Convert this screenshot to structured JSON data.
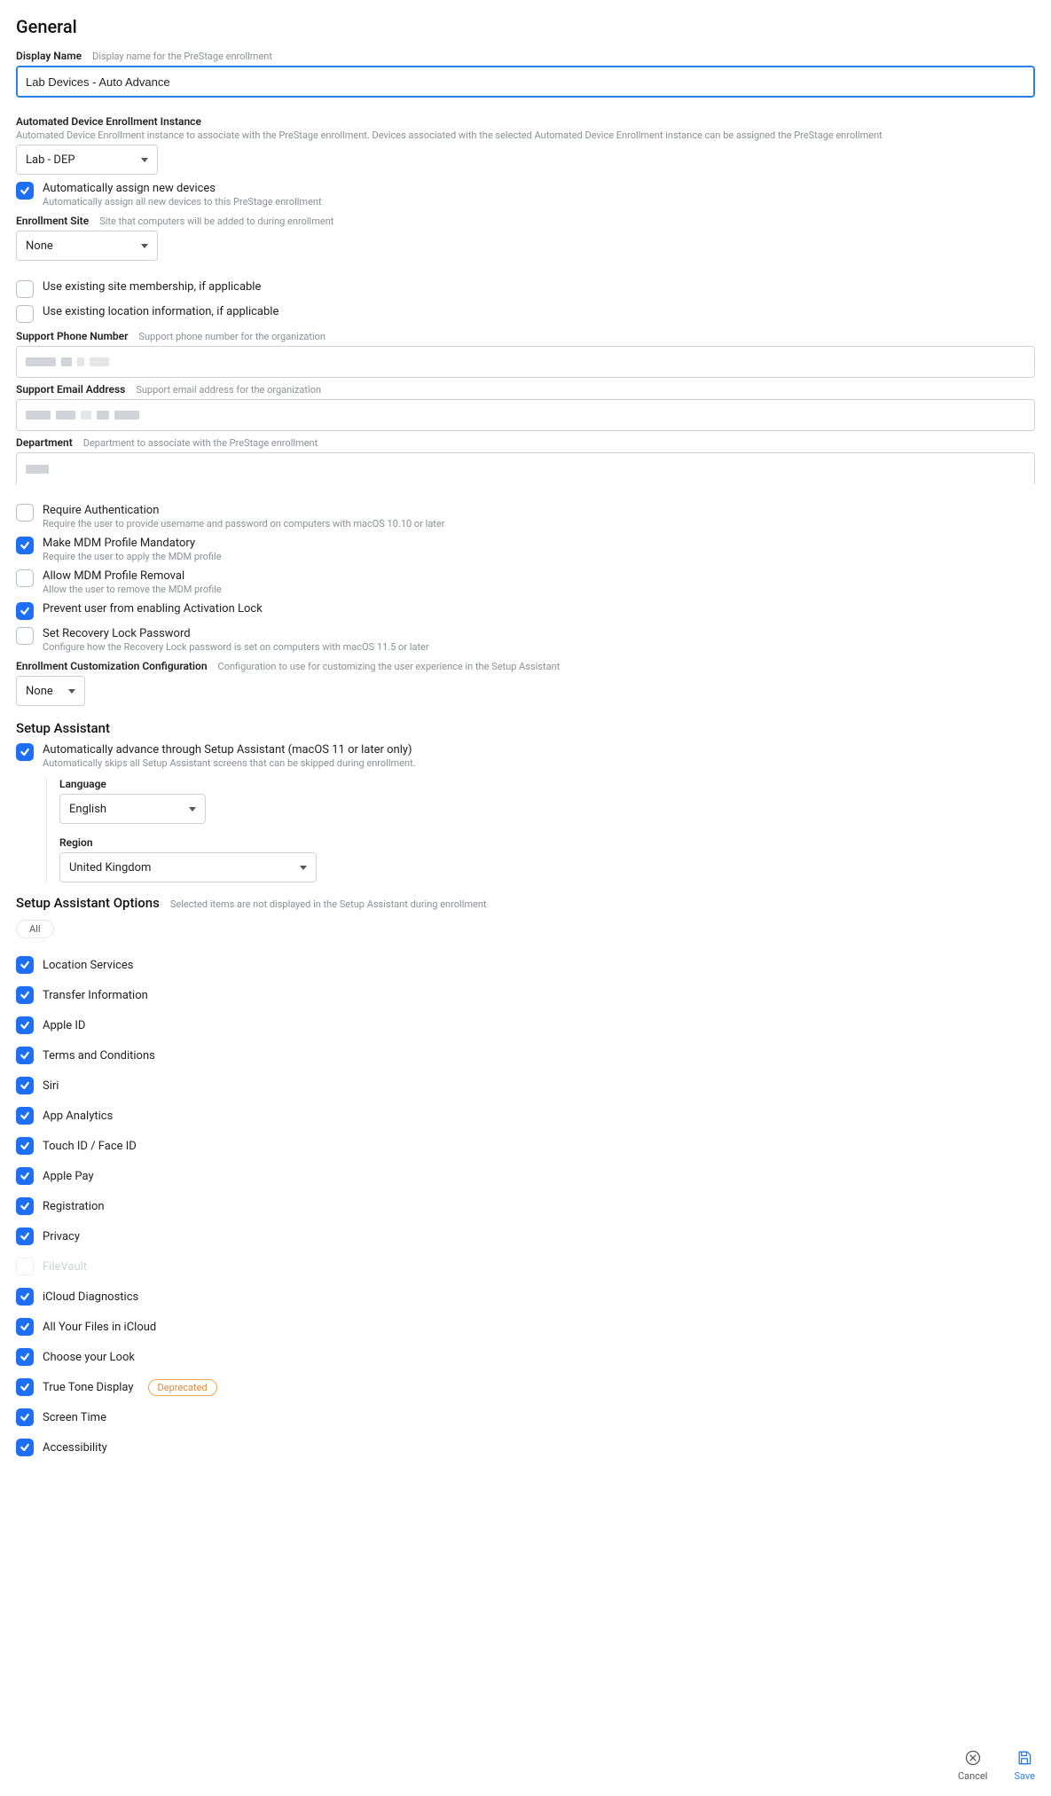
{
  "page_title": "General",
  "display_name": {
    "label": "Display Name",
    "hint": "Display name for the PreStage enrollment",
    "value": "Lab Devices - Auto Advance"
  },
  "ade": {
    "label": "Automated Device Enrollment Instance",
    "hint": "Automated Device Enrollment instance to associate with the PreStage enrollment. Devices associated with the selected Automated Device Enrollment instance can be assigned the PreStage enrollment",
    "value": "Lab - DEP"
  },
  "auto_assign": {
    "label": "Automatically assign new devices",
    "hint": "Automatically assign all new devices to this PreStage enrollment",
    "checked": true
  },
  "enroll_site": {
    "label": "Enrollment Site",
    "hint": "Site that computers will be added to during enrollment",
    "value": "None"
  },
  "use_site": {
    "label": "Use existing site membership, if applicable",
    "checked": false
  },
  "use_loc": {
    "label": "Use existing location information, if applicable",
    "checked": false
  },
  "support_phone": {
    "label": "Support Phone Number",
    "hint": "Support phone number for the organization"
  },
  "support_email": {
    "label": "Support Email Address",
    "hint": "Support email address for the organization"
  },
  "department": {
    "label": "Department",
    "hint": "Department to associate with the PreStage enrollment"
  },
  "req_auth": {
    "label": "Require Authentication",
    "hint": "Require the user to provide username and password on computers with macOS 10.10 or later",
    "checked": false
  },
  "mdm_mand": {
    "label": "Make MDM Profile Mandatory",
    "hint": "Require the user to apply the MDM profile",
    "checked": true
  },
  "mdm_remove": {
    "label": "Allow MDM Profile Removal",
    "hint": "Allow the user to remove the MDM profile",
    "checked": false
  },
  "prevent_al": {
    "label": "Prevent user from enabling Activation Lock",
    "checked": true
  },
  "recovery": {
    "label": "Set Recovery Lock Password",
    "hint": "Configure how the Recovery Lock password is set on computers with macOS 11.5 or later",
    "checked": false
  },
  "enroll_cust": {
    "label": "Enrollment Customization Configuration",
    "hint": "Configuration to use for customizing the user experience in the Setup Assistant",
    "value": "None"
  },
  "setup_assistant": {
    "title": "Setup Assistant",
    "auto_adv": {
      "label": "Automatically advance through Setup Assistant (macOS 11 or later only)",
      "hint": "Automatically skips all Setup Assistant screens that can be skipped during enrollment.",
      "checked": true
    },
    "language": {
      "label": "Language",
      "value": "English"
    },
    "region": {
      "label": "Region",
      "value": "United Kingdom"
    }
  },
  "options": {
    "title": "Setup Assistant Options",
    "hint": "Selected items are not displayed in the Setup Assistant during enrollment",
    "all_label": "All",
    "items": [
      {
        "label": "Location Services",
        "checked": true
      },
      {
        "label": "Transfer Information",
        "checked": true
      },
      {
        "label": "Apple ID",
        "checked": true
      },
      {
        "label": "Terms and Conditions",
        "checked": true
      },
      {
        "label": "Siri",
        "checked": true
      },
      {
        "label": "App Analytics",
        "checked": true
      },
      {
        "label": "Touch ID / Face ID",
        "checked": true
      },
      {
        "label": "Apple Pay",
        "checked": true
      },
      {
        "label": "Registration",
        "checked": true
      },
      {
        "label": "Privacy",
        "checked": true
      },
      {
        "label": "FileVault",
        "checked": false,
        "dim": true
      },
      {
        "label": "iCloud Diagnostics",
        "checked": true
      },
      {
        "label": "All Your Files in iCloud",
        "checked": true
      },
      {
        "label": "Choose your Look",
        "checked": true
      },
      {
        "label": "True Tone Display",
        "checked": true,
        "deprecated": true
      },
      {
        "label": "Screen Time",
        "checked": true
      },
      {
        "label": "Accessibility",
        "checked": true
      }
    ]
  },
  "deprecated_label": "Deprecated",
  "footer": {
    "cancel": "Cancel",
    "save": "Save"
  }
}
